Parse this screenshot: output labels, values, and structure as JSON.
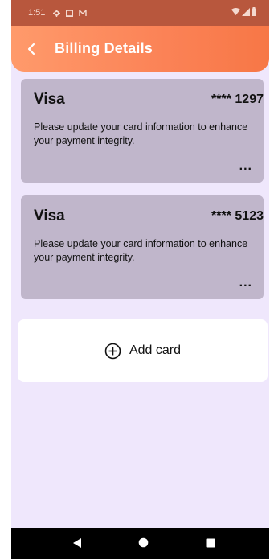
{
  "status_bar": {
    "time": "1:51",
    "notification_icons": [
      "settings-icon",
      "square-icon",
      "mail-icon"
    ],
    "system_icons": [
      "wifi-icon",
      "signal-icon",
      "battery-icon"
    ]
  },
  "header": {
    "back_icon": "chevron-left-icon",
    "title": "Billing Details"
  },
  "cards": [
    {
      "brand": "Visa",
      "masked_number": "**** 1297",
      "message": "Please update your card information to enhance your payment integrity.",
      "more_label": "..."
    },
    {
      "brand": "Visa",
      "masked_number": "**** 5123",
      "message": "Please update your card information to enhance your payment integrity.",
      "more_label": "..."
    }
  ],
  "add_card": {
    "icon": "plus-circle-icon",
    "label": "Add card"
  },
  "nav_bar": {
    "buttons": [
      "back-triangle-icon",
      "home-circle-icon",
      "recents-square-icon"
    ]
  },
  "colors": {
    "header_start": "#ff9a6b",
    "header_end": "#f77746",
    "status_bar": "#b8573d",
    "background": "#efe7fc",
    "card": "#c0b6cb",
    "add_card_bg": "#ffffff"
  }
}
